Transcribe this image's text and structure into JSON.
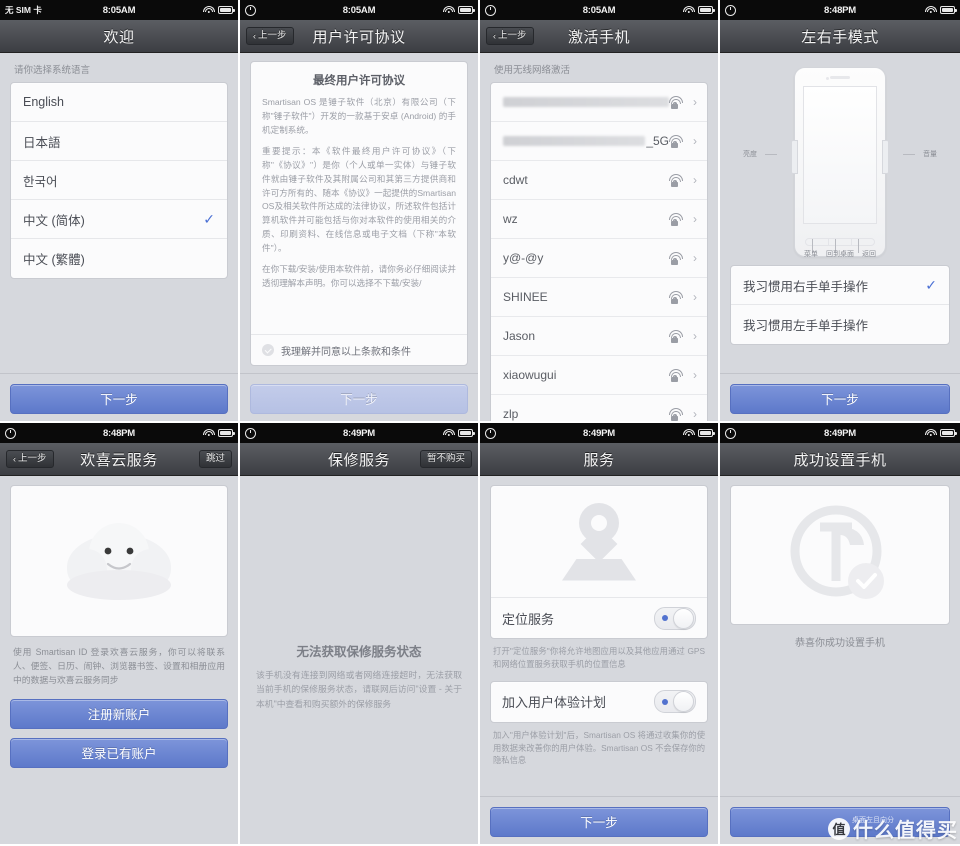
{
  "watermark": {
    "badge": "值",
    "text": "什么值得买",
    "sub": "桌面左且向分"
  },
  "common": {
    "back_label": "上一步",
    "next_label": "下一步",
    "chevron": "‹",
    "check_glyph": "✓",
    "arrow_glyph": "›"
  },
  "panels": [
    {
      "id": "welcome",
      "status": {
        "carrier": "无 SIM 卡",
        "clock": "8:05AM",
        "wifi": "wifi-icon",
        "battery": "battery-icon"
      },
      "nav": {
        "title": "欢迎",
        "back": null,
        "right": null
      },
      "section_label": "请你选择系统语言",
      "languages": [
        {
          "label": "English",
          "selected": false
        },
        {
          "label": "日本語",
          "selected": false
        },
        {
          "label": "한국어",
          "selected": false
        },
        {
          "label": "中文 (简体)",
          "selected": true
        },
        {
          "label": "中文 (繁體)",
          "selected": false
        }
      ],
      "button": {
        "label": "下一步",
        "disabled": false
      }
    },
    {
      "id": "eula",
      "status": {
        "carrier": "alarm-icon",
        "clock": "8:05AM"
      },
      "nav": {
        "title": "用户许可协议",
        "back": "上一步",
        "right": null
      },
      "eula_title": "最终用户许可协议",
      "paragraphs": [
        "Smartisan OS 是锤子软件（北京）有限公司（下称\"锤子软件\"）开发的一款基于安卓 (Android) 的手机定制系统。",
        "重要提示：本《软件最终用户许可协议》（下称\"《协议》\"）是你（个人或单一实体）与锤子软件就由锤子软件及其附属公司和其第三方提供商和许可方所有的、随本《协议》一起提供的Smartisan OS及相关软件所达成的法律协议，所述软件包括计算机软件并可能包括与你对本软件的使用相关的介质、印刷资料、在线信息或电子文档（下称\"本软件\"）。",
        "在你下载/安装/使用本软件前，请你务必仔细阅读并透彻理解本声明。你可以选择不下载/安装/"
      ],
      "agree_label": "我理解并同意以上条款和条件",
      "button": {
        "label": "下一步",
        "disabled": true
      }
    },
    {
      "id": "activate",
      "status": {
        "carrier": "alarm-icon",
        "clock": "8:05AM"
      },
      "nav": {
        "title": "激活手机",
        "back": "上一步",
        "right": null
      },
      "section_label": "使用无线网络激活",
      "networks": [
        {
          "ssid": "",
          "blurred": true,
          "secured": true
        },
        {
          "ssid": "_5G",
          "blurred": true,
          "secured": true
        },
        {
          "ssid": "cdwt",
          "blurred": false,
          "secured": true
        },
        {
          "ssid": "wz",
          "blurred": false,
          "secured": true
        },
        {
          "ssid": "y@-@y",
          "blurred": false,
          "secured": true
        },
        {
          "ssid": "SHINEE",
          "blurred": false,
          "secured": true
        },
        {
          "ssid": "Jason",
          "blurred": false,
          "secured": true
        },
        {
          "ssid": "xiaowugui",
          "blurred": false,
          "secured": true
        },
        {
          "ssid": "zlp",
          "blurred": false,
          "secured": true
        }
      ]
    },
    {
      "id": "handedness",
      "status": {
        "carrier": "alarm-icon",
        "clock": "8:48PM"
      },
      "nav": {
        "title": "左右手模式",
        "back": null,
        "right": null
      },
      "diagram": {
        "left_label": "亮度",
        "right_label": "音量",
        "bottom_labels": [
          "菜单",
          "回到桌面",
          "返回"
        ]
      },
      "options": [
        {
          "label": "我习惯用右手单手操作",
          "selected": true
        },
        {
          "label": "我习惯用左手单手操作",
          "selected": false
        }
      ],
      "button": {
        "label": "下一步",
        "disabled": false
      }
    },
    {
      "id": "cloud",
      "status": {
        "carrier": "alarm-icon",
        "clock": "8:48PM"
      },
      "nav": {
        "title": "欢喜云服务",
        "back": "上一步",
        "right": "跳过"
      },
      "illustration": "cloud-mascot-icon",
      "desc": "使用 Smartisan ID 登录欢喜云服务，你可以将联系人、便签、日历、闹钟、浏览器书签、设置和相册应用中的数据与欢喜云服务同步",
      "buttons": [
        {
          "label": "注册新账户",
          "disabled": false
        },
        {
          "label": "登录已有账户",
          "disabled": false
        }
      ]
    },
    {
      "id": "warranty",
      "status": {
        "carrier": "alarm-icon",
        "clock": "8:49PM"
      },
      "nav": {
        "title": "保修服务",
        "back": null,
        "right": "暂不购买"
      },
      "title": "无法获取保修服务状态",
      "desc": "该手机没有连接到网络或者网络连接超时，无法获取当前手机的保修服务状态，请联网后访问\"设置 - 关于本机\"中查看和购买额外的保修服务"
    },
    {
      "id": "services",
      "status": {
        "carrier": "alarm-icon",
        "clock": "8:49PM"
      },
      "nav": {
        "title": "服务",
        "back": null,
        "right": null
      },
      "illustration": "location-pin-icon",
      "settings": [
        {
          "label": "定位服务",
          "enabled": true,
          "note": "打开\"定位服务\"你将允许地图应用以及其他应用通过 GPS 和网络位置服务获取手机的位置信息"
        },
        {
          "label": "加入用户体验计划",
          "enabled": true,
          "note": "加入\"用户体验计划\"后，Smartisan OS 将通过收集你的使用数据来改善你的用户体验。Smartisan OS 不会保存你的隐私信息"
        }
      ],
      "button": {
        "label": "下一步",
        "disabled": false
      }
    },
    {
      "id": "done",
      "status": {
        "carrier": "alarm-icon",
        "clock": "8:49PM"
      },
      "nav": {
        "title": "成功设置手机",
        "back": null,
        "right": null
      },
      "illustration": "smartisan-hammer-logo-icon",
      "caption": "恭喜你成功设置手机",
      "button": {
        "label": "",
        "disabled": false
      }
    }
  ]
}
